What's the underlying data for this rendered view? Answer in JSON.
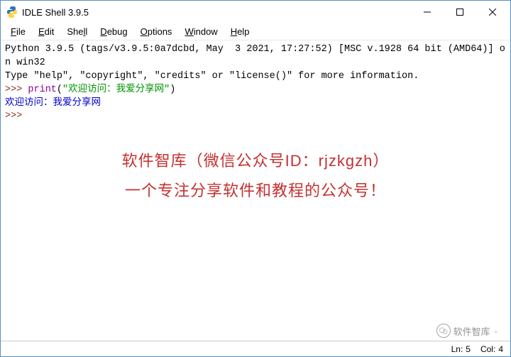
{
  "window": {
    "title": "IDLE Shell 3.9.5"
  },
  "menu": {
    "file": "File",
    "edit": "Edit",
    "shell": "Shell",
    "debug": "Debug",
    "options": "Options",
    "window": "Window",
    "help": "Help"
  },
  "shell": {
    "banner_line1": "Python 3.9.5 (tags/v3.9.5:0a7dcbd, May  3 2021, 17:27:52) [MSC v.1928 64 bit (AMD64)] on win32",
    "banner_line2": "Type \"help\", \"copyright\", \"credits\" or \"license()\" for more information.",
    "prompt": ">>> ",
    "builtin_name": "print",
    "paren_open": "(",
    "string_literal": "\"欢迎访问：我爱分享网\"",
    "paren_close": ")",
    "output": "欢迎访问：我爱分享网",
    "prompt2": ">>>"
  },
  "overlay": {
    "line1": "软件智库（微信公众号ID：rjzkgzh）",
    "line2": "一个专注分享软件和教程的公众号！"
  },
  "watermark": {
    "text": "软件智库"
  },
  "status": {
    "ln_label": "Ln:",
    "ln_value": "5",
    "col_label": "Col:",
    "col_value": "4"
  }
}
